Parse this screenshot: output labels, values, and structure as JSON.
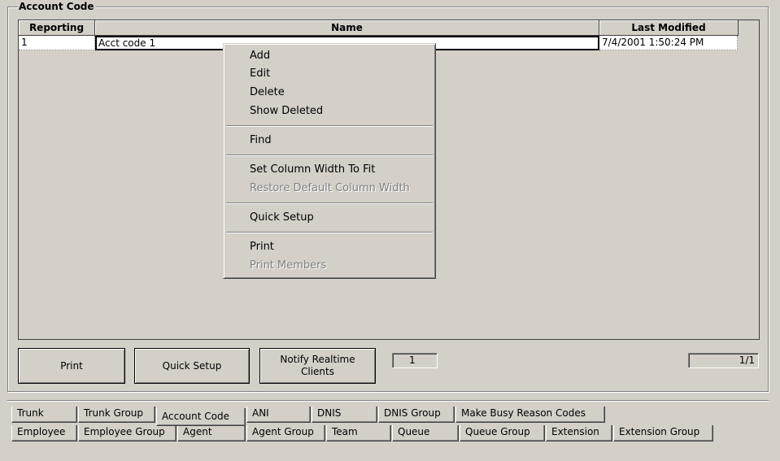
{
  "group": {
    "title": "Account Code"
  },
  "grid": {
    "columns": [
      "Reporting",
      "Name",
      "Last Modified"
    ],
    "rows": [
      {
        "reporting": "1",
        "name": "Acct code 1",
        "last_modified": "7/4/2001 1:50:24 PM"
      }
    ]
  },
  "context_menu": {
    "items": [
      {
        "label": "Add",
        "enabled": true
      },
      {
        "label": "Edit",
        "enabled": true
      },
      {
        "label": "Delete",
        "enabled": true
      },
      {
        "label": "Show Deleted",
        "enabled": true
      },
      {
        "label": "Find",
        "enabled": true
      },
      {
        "label": "Set Column Width To Fit",
        "enabled": true
      },
      {
        "label": "Restore Default Column Width",
        "enabled": false
      },
      {
        "label": "Quick Setup",
        "enabled": true
      },
      {
        "label": "Print",
        "enabled": true
      },
      {
        "label": "Print Members",
        "enabled": false
      }
    ]
  },
  "buttons": {
    "print": "Print",
    "quick_setup": "Quick Setup",
    "notify_line1": "Notify Realtime",
    "notify_line2": "Clients"
  },
  "status": {
    "count": "1",
    "page": "1/1"
  },
  "tabs": {
    "row1": [
      "Trunk",
      "Trunk Group",
      "Account Code",
      "ANI",
      "DNIS",
      "DNIS Group",
      "Make Busy Reason Codes"
    ],
    "row2": [
      "Employee",
      "Employee Group",
      "Agent",
      "Agent Group",
      "Team",
      "Queue",
      "Queue Group",
      "Extension",
      "Extension Group"
    ],
    "active": "Account Code"
  },
  "colors": {
    "face": "#d4d0c8",
    "shadow": "#808080",
    "highlight": "#ffffff"
  }
}
